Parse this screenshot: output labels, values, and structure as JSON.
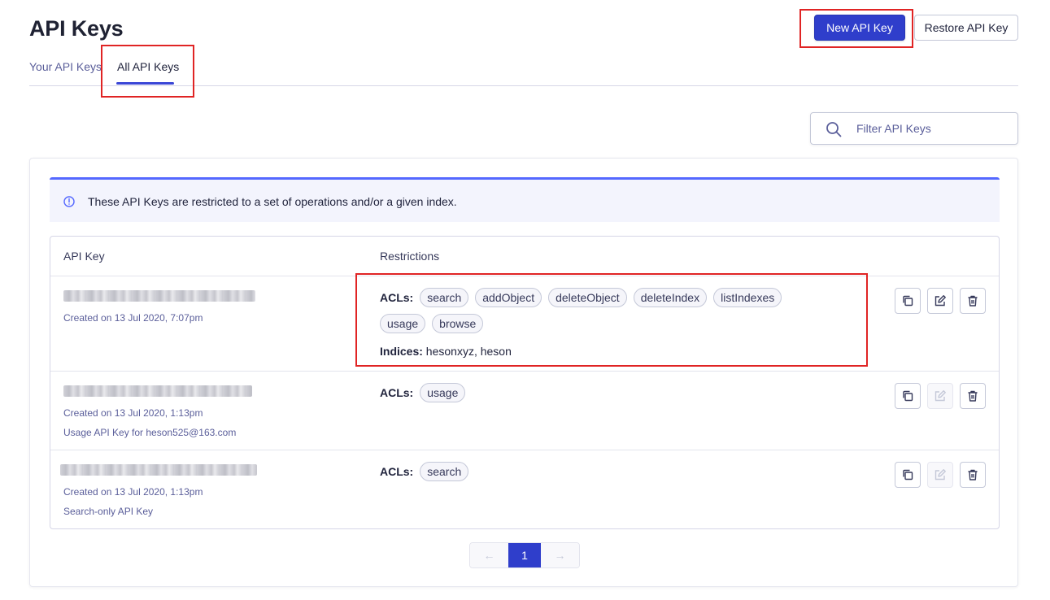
{
  "header": {
    "title": "API Keys",
    "new_key_label": "New API Key",
    "restore_key_label": "Restore API Key"
  },
  "tabs": [
    {
      "label": "Your API Keys",
      "active": false
    },
    {
      "label": "All API Keys",
      "active": true
    }
  ],
  "search": {
    "placeholder": "Filter API Keys",
    "value": ""
  },
  "banner": {
    "text": "These API Keys are restricted to a set of operations and/or a given index."
  },
  "table": {
    "columns": [
      "API Key",
      "Restrictions"
    ],
    "rows": [
      {
        "created": "Created on 13 Jul 2020, 7:07pm",
        "description": "",
        "acl_label": "ACLs:",
        "acls": [
          "search",
          "addObject",
          "deleteObject",
          "deleteIndex",
          "listIndexes",
          "usage",
          "browse"
        ],
        "indices_label": "Indices:",
        "indices": "hesonxyz, heson",
        "edit_enabled": true
      },
      {
        "created": "Created on 13 Jul 2020, 1:13pm",
        "description": "Usage API Key for heson525@163.com",
        "acl_label": "ACLs:",
        "acls": [
          "usage"
        ],
        "edit_enabled": false
      },
      {
        "created": "Created on 13 Jul 2020, 1:13pm",
        "description": "Search-only API Key",
        "acl_label": "ACLs:",
        "acls": [
          "search"
        ],
        "edit_enabled": false
      }
    ]
  },
  "pagination": {
    "prev": "←",
    "current": "1",
    "next": "→"
  },
  "colors": {
    "primary": "#2f3ecb",
    "annotation": "#e02424",
    "banner_border": "#5468ff"
  }
}
